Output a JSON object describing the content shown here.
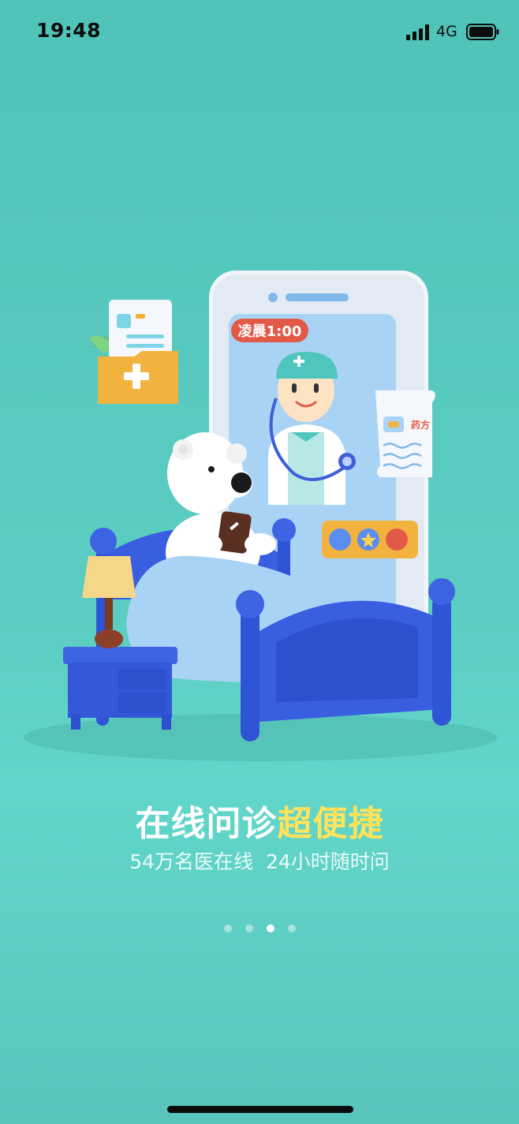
{
  "status_bar": {
    "time": "19:48",
    "network": "4G"
  },
  "illustration": {
    "time_badge": "凌晨1:00",
    "prescription_label": "药方"
  },
  "headline": {
    "part1": "在线问诊",
    "part2": "超便捷"
  },
  "subtitle": "54万名医在线  24小时随时问",
  "pager": {
    "count": 4,
    "active_index": 2
  },
  "colors": {
    "accent_yellow": "#ffe35a",
    "background": "#5ccdc2"
  }
}
